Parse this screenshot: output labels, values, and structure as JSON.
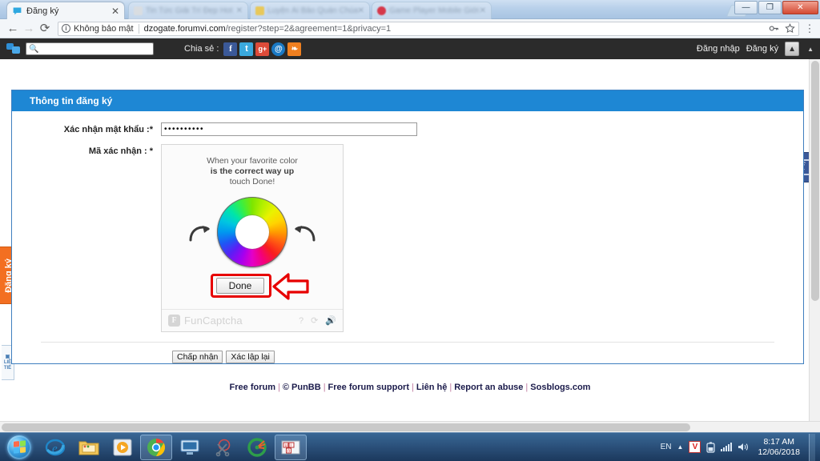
{
  "browser": {
    "active_tab": {
      "title": "Đăng ký",
      "favicon": "chat-bubble-icon",
      "close": "✕"
    },
    "ghost_tabs": [
      {
        "title": "Tin Tức Giải Trí Đẹp Hot"
      },
      {
        "title": "Luyện Ái Bảo Quán Chúa"
      },
      {
        "title": "Game Player Mobile Giới"
      }
    ],
    "nav": {
      "back": "←",
      "forward": "→",
      "reload": "⟳"
    },
    "omnibox": {
      "security_label": "Không bảo mật",
      "security_icon": "info-circle-icon",
      "url_host": "dzogate.forumvi.com",
      "url_path": "/register?step=2&agreement=1&privacy=1",
      "key_icon": "key-icon",
      "star_icon": "star-icon",
      "menu_icon": "kebab-menu-icon"
    },
    "window_controls": {
      "minimize": "—",
      "maximize": "❐",
      "close": "✕"
    }
  },
  "forum_toolbar": {
    "logo": "forumotion-logo-icon",
    "search_placeholder": "",
    "search_value": "",
    "share_label": "Chia sẻ :",
    "social": [
      {
        "name": "facebook-share-icon",
        "glyph": "f"
      },
      {
        "name": "twitter-share-icon",
        "glyph": "t"
      },
      {
        "name": "googleplus-share-icon",
        "glyph": "g+"
      },
      {
        "name": "email-share-icon",
        "glyph": "@"
      },
      {
        "name": "rss-share-icon",
        "glyph": "❧"
      }
    ],
    "login_label": "Đăng nhập",
    "register_label": "Đăng ký",
    "scroll_top_icon": "arrow-up-icon"
  },
  "page": {
    "panel_title": "Thông tin đăng ký",
    "fields": [
      {
        "label": "Xác nhận mật khẩu :*",
        "value": "••••••••••",
        "type": "password"
      },
      {
        "label": "Mã xác nhận : *",
        "type": "captcha"
      }
    ],
    "captcha": {
      "line1": "When your favorite color",
      "line2": "is the correct way up",
      "line3": "touch Done!",
      "left_arrow_icon": "rotate-right-arrow-icon",
      "right_arrow_icon": "rotate-left-arrow-icon",
      "wheel_icon": "color-wheel",
      "done_button": "Done",
      "cursor_icon": "big-red-arrow-pointer",
      "brand": "FunCaptcha",
      "brand_mark": "F",
      "help_icon": "question-mark-icon",
      "reload_icon": "refresh-icon",
      "audio_icon": "speaker-icon"
    },
    "buttons": [
      {
        "label": "Chấp nhận",
        "name": "accept-button"
      },
      {
        "label": "Xác lập lại",
        "name": "reset-button"
      }
    ],
    "footer": {
      "links": [
        "Free forum",
        "© PunBB",
        "Free forum support",
        "Liên hệ",
        "Report an abuse",
        "Sosblogs.com"
      ],
      "separator": "|"
    },
    "side_tab_label": "Đăng ký",
    "side_mini_label": "LIÊN TIẾP",
    "facebook_badge_icon": "facebook-icon"
  },
  "taskbar": {
    "start_icon": "windows-start-orb",
    "items": [
      {
        "name": "internet-explorer-icon"
      },
      {
        "name": "windows-explorer-icon"
      },
      {
        "name": "media-player-icon"
      },
      {
        "name": "google-chrome-icon",
        "pinned": true
      },
      {
        "name": "remote-desktop-icon"
      },
      {
        "name": "snipping-tool-icon"
      },
      {
        "name": "ccleaner-icon"
      },
      {
        "name": "unikey-icon",
        "pinned": true
      }
    ],
    "tray": {
      "language": "EN",
      "show_hidden_icon": "chevron-up-icon",
      "antivirus_icon": "V",
      "battery_icon": "battery-icon",
      "network_icon": "signal-bars-icon",
      "volume_icon": "speaker-icon",
      "time": "8:17 AM",
      "date": "12/06/2018"
    }
  }
}
